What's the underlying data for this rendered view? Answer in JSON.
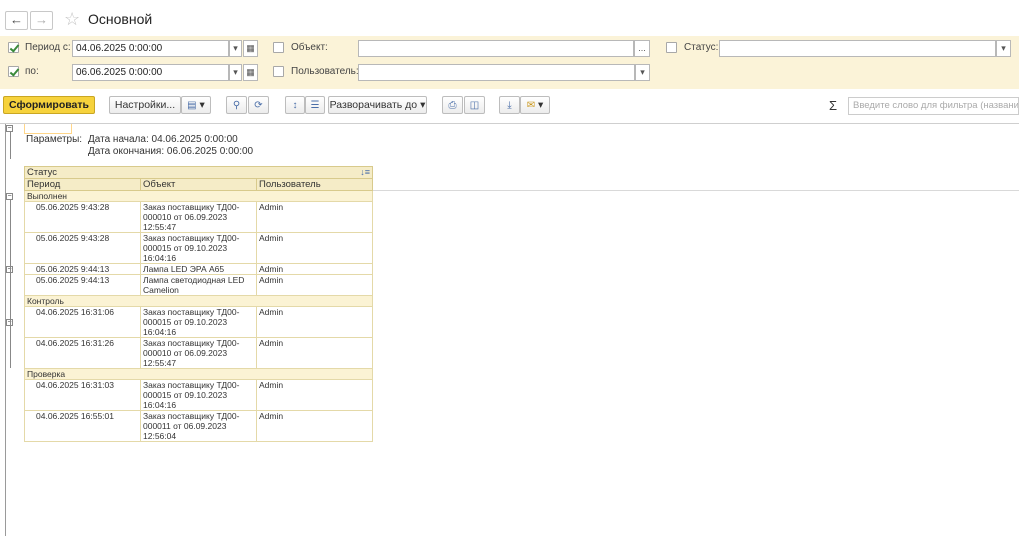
{
  "header": {
    "back_glyph": "←",
    "forward_glyph": "→",
    "star_glyph": "☆",
    "title": "Основной"
  },
  "filters": {
    "period_from": {
      "checked": true,
      "label": "Период с:",
      "value": "04.06.2025  0:00:00"
    },
    "period_to": {
      "checked": true,
      "label": "по:",
      "value": "06.06.2025  0:00:00"
    },
    "object": {
      "checked": false,
      "label": "Объект:",
      "value": ""
    },
    "user": {
      "checked": false,
      "label": "Пользователь:",
      "value": ""
    },
    "status": {
      "checked": false,
      "label": "Статус:",
      "value": ""
    },
    "dropdown_glyph": "▾",
    "calendar_glyph": "▦",
    "select_glyph": "..."
  },
  "toolbar": {
    "generate_label": "Сформировать",
    "settings_label": "Настройки...",
    "expand_label": "Разворачивать до",
    "search_placeholder": "Введите слово для фильтра (название",
    "sigma": "Σ"
  },
  "report": {
    "params_label": "Параметры:",
    "start_text": "Дата начала: 04.06.2025 0:00:00",
    "end_text": "Дата окончания: 06.06.2025 0:00:00",
    "columns": {
      "status": "Статус",
      "period": "Период",
      "object": "Объект",
      "user": "Пользователь"
    },
    "groups": [
      {
        "name": "Выполнен",
        "rows": [
          {
            "period": "05.06.2025 9:43:28",
            "object": "Заказ поставщику ТД00-000010 от 06.09.2023 12:55:47",
            "user": "Admin"
          },
          {
            "period": "05.06.2025 9:43:28",
            "object": "Заказ поставщику ТД00-000015 от 09.10.2023 16:04:16",
            "user": "Admin"
          },
          {
            "period": "05.06.2025 9:44:13",
            "object": "Лампа LED ЭРА А65",
            "user": "Admin"
          },
          {
            "period": "05.06.2025 9:44:13",
            "object": "Лампа светодиодная LED Camelion",
            "user": "Admin"
          }
        ]
      },
      {
        "name": "Контроль",
        "rows": [
          {
            "period": "04.06.2025 16:31:06",
            "object": "Заказ поставщику ТД00-000015 от 09.10.2023 16:04:16",
            "user": "Admin"
          },
          {
            "period": "04.06.2025 16:31:26",
            "object": "Заказ поставщику ТД00-000010 от 06.09.2023 12:55:47",
            "user": "Admin"
          }
        ]
      },
      {
        "name": "Проверка",
        "rows": [
          {
            "period": "04.06.2025 16:31:03",
            "object": "Заказ поставщику ТД00-000015 от 09.10.2023 16:04:16",
            "user": "Admin"
          },
          {
            "period": "04.06.2025 16:55:01",
            "object": "Заказ поставщику ТД00-000011 от 06.09.2023 12:56:04",
            "user": "Admin"
          }
        ]
      }
    ]
  }
}
